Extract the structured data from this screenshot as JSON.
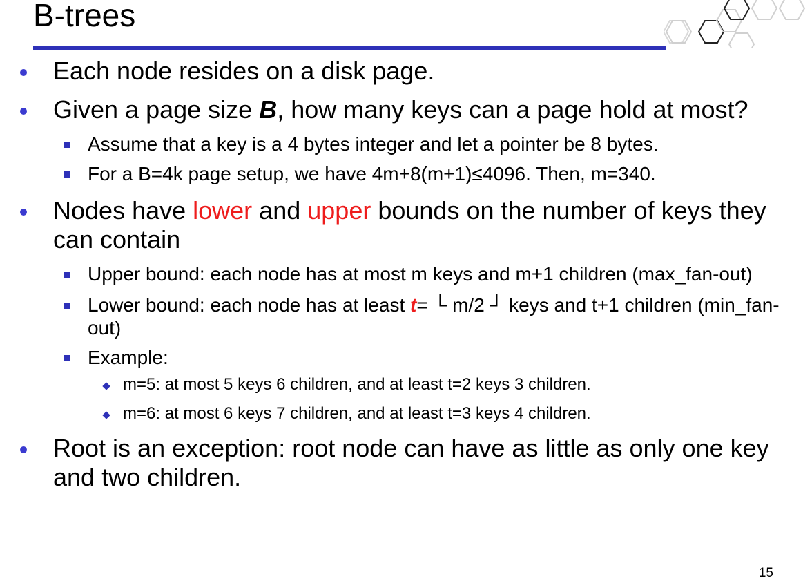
{
  "slide": {
    "title": "B-trees",
    "page_number": "15",
    "accent_color": "#2e31b8",
    "highlight_color": "#ee1c1c"
  },
  "bullets": {
    "b1": "Each node resides on a disk page.",
    "b2_pre": "Given a page size ",
    "b2_var": "B",
    "b2_post": ", how many keys can a page hold at most?",
    "b2_sub1": "Assume that a key is a 4 bytes integer and let a pointer be 8 bytes.",
    "b2_sub2": "For a B=4k page setup, we have 4m+8(m+1)≤4096. Then, m=340.",
    "b3_pre": "Nodes have ",
    "b3_lower": "lower",
    "b3_mid": " and ",
    "b3_upper": "upper",
    "b3_post": " bounds on the number of keys they can contain",
    "b3_sub1": "Upper bound: each node has at most m keys and m+1 children (max_fan-out)",
    "b3_sub2_pre": "Lower bound: each node has at least ",
    "b3_sub2_var": "t",
    "b3_sub2_post": "= └ m/2 ┘ keys and t+1 children (min_fan-out)",
    "b3_sub3": "Example:",
    "b3_sub3_ex1": "m=5: at most 5 keys 6 children, and at least t=2 keys 3 children.",
    "b3_sub3_ex2": "m=6: at most 6 keys 7 children, and at least t=3 keys 4 children.",
    "b4": "Root is an exception: root node can have as little as only one key and two children."
  }
}
